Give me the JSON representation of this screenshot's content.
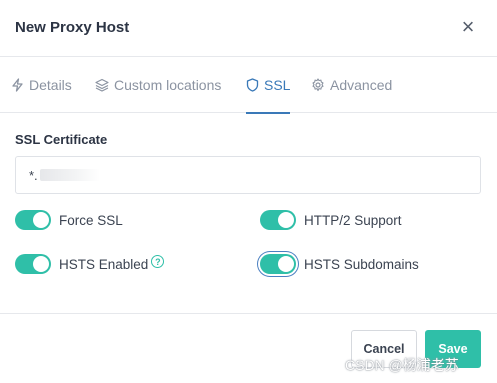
{
  "modal": {
    "title": "New Proxy Host",
    "close_symbol": "×"
  },
  "tabs": [
    {
      "label": "Details",
      "icon": "lightning-icon"
    },
    {
      "label": "Custom locations",
      "icon": "layers-icon"
    },
    {
      "label": "SSL",
      "icon": "shield-icon",
      "active": true
    },
    {
      "label": "Advanced",
      "icon": "gear-icon"
    }
  ],
  "ssl": {
    "certificate_label": "SSL Certificate",
    "certificate_value": "*.",
    "options": {
      "force_ssl": {
        "label": "Force SSL",
        "enabled": true
      },
      "http2": {
        "label": "HTTP/2 Support",
        "enabled": true
      },
      "hsts": {
        "label": "HSTS Enabled",
        "enabled": true,
        "help": "?"
      },
      "hsts_subdomains": {
        "label": "HSTS Subdomains",
        "enabled": true
      }
    }
  },
  "footer": {
    "cancel_label": "Cancel",
    "save_label": "Save"
  },
  "watermark": "CSDN @杨浦老苏",
  "colors": {
    "accent": "#2fbfa8",
    "active_tab": "#3a79b8",
    "text": "#3b4351"
  }
}
